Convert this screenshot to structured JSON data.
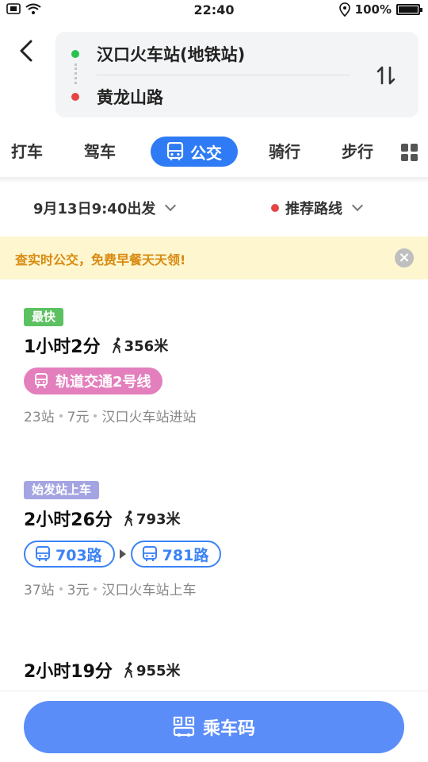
{
  "status_bar": {
    "time": "22:40",
    "battery": "100%",
    "icons": [
      "sim-icon",
      "wifi-icon",
      "location-icon",
      "battery-icon"
    ]
  },
  "route": {
    "from": "汉口火车站(地铁站)",
    "to": "黄龙山路",
    "from_color": "#27c24c",
    "to_color": "#e64545"
  },
  "tabs": {
    "items": [
      "打车",
      "驾车",
      "公交",
      "骑行",
      "步行"
    ],
    "active": "公交",
    "active_color": "#2f7bf5"
  },
  "filters": {
    "departure": "9月13日9:40出发",
    "preference": "推荐路线"
  },
  "notice": {
    "text": "查实时公交，免费早餐天天领!"
  },
  "options": [
    {
      "badge": "最快",
      "duration": "1小时2分",
      "walk": "356米",
      "lines": [
        "轨道交通2号线"
      ],
      "stops": "23站",
      "price": "7元",
      "station": "汉口火车站进站"
    },
    {
      "badge": "始发站上车",
      "duration": "2小时26分",
      "walk": "793米",
      "lines": [
        "703路",
        "781路"
      ],
      "stops": "37站",
      "price": "3元",
      "station": "汉口火车站上车"
    },
    {
      "duration": "2小时19分",
      "walk": "955米"
    }
  ],
  "bottom": {
    "button_label": "乘车码",
    "button_color": "#5b8df9"
  }
}
